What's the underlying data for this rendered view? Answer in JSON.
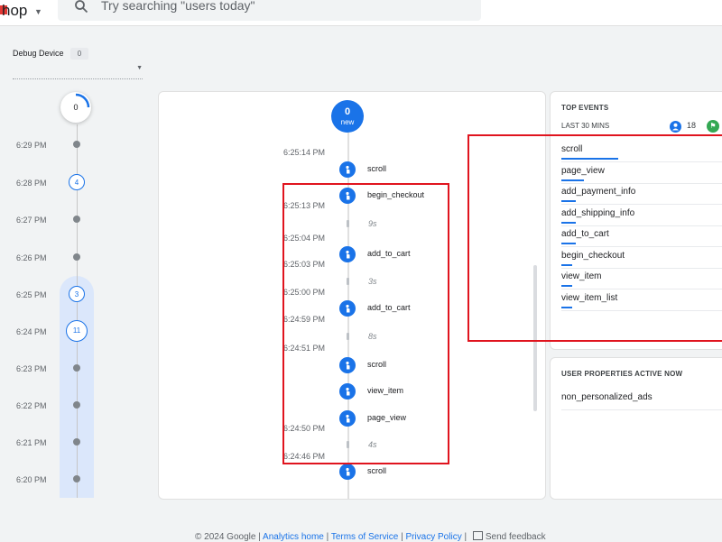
{
  "header": {
    "brand_text": "hop",
    "search_placeholder": "Try searching \"users today\""
  },
  "debug_device": {
    "label": "Debug Device",
    "count": "0"
  },
  "minutes": {
    "top_count": "0",
    "rows": [
      {
        "label": "6:29 PM",
        "count": null
      },
      {
        "label": "6:28 PM",
        "count": "4"
      },
      {
        "label": "6:27 PM",
        "count": null
      },
      {
        "label": "6:26 PM",
        "count": null
      },
      {
        "label": "6:25 PM",
        "count": "3"
      },
      {
        "label": "6:24 PM",
        "count": "11"
      },
      {
        "label": "6:23 PM",
        "count": null
      },
      {
        "label": "6:22 PM",
        "count": null
      },
      {
        "label": "6:21 PM",
        "count": null
      },
      {
        "label": "6:20 PM",
        "count": null
      }
    ]
  },
  "stream": {
    "new_count": "0",
    "new_label": "new",
    "timestamps": [
      "6:25:14 PM",
      "6:25:13 PM",
      "6:25:04 PM",
      "6:25:03 PM",
      "6:25:00 PM",
      "6:24:59 PM",
      "6:24:51 PM",
      "6:24:50 PM",
      "6:24:46 PM"
    ],
    "events": [
      "scroll",
      "begin_checkout",
      "add_to_cart",
      "add_to_cart",
      "scroll",
      "view_item",
      "page_view",
      "scroll"
    ],
    "gaps": [
      "9s",
      "3s",
      "8s",
      "4s"
    ]
  },
  "top_events": {
    "title": "TOP EVENTS",
    "range_label": "LAST 30 MINS",
    "user_count": "18",
    "flag_icon": "flag-icon",
    "items": [
      {
        "label": "scroll",
        "share": 0.36
      },
      {
        "label": "page_view",
        "share": 0.14
      },
      {
        "label": "add_payment_info",
        "share": 0.09
      },
      {
        "label": "add_shipping_info",
        "share": 0.09
      },
      {
        "label": "add_to_cart",
        "share": 0.09
      },
      {
        "label": "begin_checkout",
        "share": 0.07
      },
      {
        "label": "view_item",
        "share": 0.07
      },
      {
        "label": "view_item_list",
        "share": 0.07
      }
    ]
  },
  "user_properties": {
    "title": "USER PROPERTIES ACTIVE NOW",
    "items": [
      "non_personalized_ads"
    ]
  },
  "footer": {
    "copyright": "© 2024 Google | ",
    "links": [
      "Analytics home",
      "Terms of Service",
      "Privacy Policy"
    ],
    "separator": " | ",
    "feedback": "Send feedback"
  },
  "colors": {
    "accent": "#1a73e8",
    "annotation_red": "#e0141e",
    "status_green": "#34a853"
  }
}
